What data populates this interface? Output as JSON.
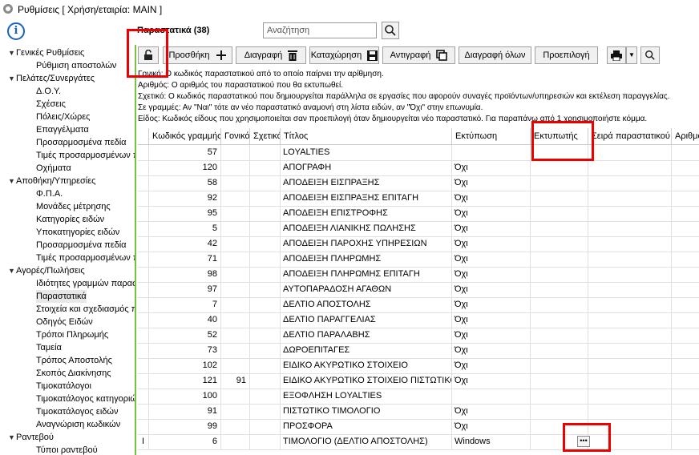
{
  "window": {
    "title": "Ρυθμίσεις   [ Χρήση/εταιρία: MAIN ]"
  },
  "sidebar": {
    "items": [
      {
        "label": "Γενικές Ρυθμίσεις",
        "group": true
      },
      {
        "label": "Ρύθμιση αποστολών",
        "group": false
      },
      {
        "label": "Πελάτες/Συνεργάτες",
        "group": true
      },
      {
        "label": "Δ.Ο.Υ.",
        "group": false
      },
      {
        "label": "Σχέσεις",
        "group": false
      },
      {
        "label": "Πόλεις/Χώρες",
        "group": false
      },
      {
        "label": "Επαγγέλματα",
        "group": false
      },
      {
        "label": "Προσαρμοσμένα πεδία",
        "group": false
      },
      {
        "label": "Τιμές προσαρμοσμένων π",
        "group": false
      },
      {
        "label": "Οχήματα",
        "group": false
      },
      {
        "label": "Αποθήκη/Υπηρεσίες",
        "group": true
      },
      {
        "label": "Φ.Π.Α.",
        "group": false
      },
      {
        "label": "Μονάδες μέτρησης",
        "group": false
      },
      {
        "label": "Κατηγορίες ειδών",
        "group": false
      },
      {
        "label": "Υποκατηγορίες ειδών",
        "group": false
      },
      {
        "label": "Προσαρμοσμένα πεδία",
        "group": false
      },
      {
        "label": "Τιμές προσαρμοσμένων π",
        "group": false
      },
      {
        "label": "Αγορές/Πωλήσεις",
        "group": true
      },
      {
        "label": "Ιδιότητες γραμμών παρασ",
        "group": false
      },
      {
        "label": "Παραστατικά",
        "group": false,
        "selected": true
      },
      {
        "label": "Στοιχεία και σχεδιασμός π",
        "group": false
      },
      {
        "label": "Οδηγός Ειδών",
        "group": false
      },
      {
        "label": "Τρόποι Πληρωμής",
        "group": false
      },
      {
        "label": "Ταμεία",
        "group": false
      },
      {
        "label": "Τρόπος Αποστολής",
        "group": false
      },
      {
        "label": "Σκοπός Διακίνησης",
        "group": false
      },
      {
        "label": "Τιμοκατάλογοι",
        "group": false
      },
      {
        "label": "Τιμοκατάλογος κατηγοριώ",
        "group": false
      },
      {
        "label": "Τιμοκατάλογος ειδών",
        "group": false
      },
      {
        "label": "Αναγνώριση κωδικών",
        "group": false
      },
      {
        "label": "Ραντεβού",
        "group": true
      },
      {
        "label": "Τύποι ραντεβού",
        "group": false
      }
    ]
  },
  "main": {
    "section_title": "Παραστατικά (38)",
    "search_placeholder": "Αναζήτηση"
  },
  "toolbar": {
    "add": "Προσθήκη",
    "delete": "Διαγραφή",
    "save": "Καταχώρηση",
    "copy": "Αντιγραφή",
    "delete_all": "Διαγραφή όλων",
    "default": "Προεπιλογή"
  },
  "info_lines": [
    "Γονικό: Ο κωδικός παραστατικού από το οποίο παίρνει την αρίθμηση.",
    "Αριθμός: Ο αριθμός του παραστατικού που θα εκτυπωθεί.",
    "Σχετικό: Ο κωδικός παραστατικού που δημιουργείται παράλληλα σε εργασίες που αφορούν συναγές προϊόντων/υπηρεσιών και εκτέλεση παραγγελίας.",
    "Σε γραμμές: Αν \"Ναι\" τότε αν νέο παραστατικό αναμονή στη λίστα ειδών, αν \"Όχι\" στην επωνυμία.",
    "Είδος: Κωδικός είδους που χρησιμοποιείται σαν προεπιλογή όταν δημιουργείται νέο παραστατικό. Για παραπάνω από 1 χρησιμοποιήστε κόμμα."
  ],
  "grid": {
    "columns": [
      "Κωδικός γραμμής",
      "Γονικό",
      "Σχετικό",
      "Τίτλος",
      "Εκτύπωση",
      "Εκτυπωτής",
      "Σειρά παραστατικού",
      "Αριθμό"
    ],
    "rows": [
      {
        "code": "57",
        "parent": "",
        "title": "LOYALTIES",
        "print": "",
        "printer": ""
      },
      {
        "code": "120",
        "parent": "",
        "title": "ΑΠΟΓΡΑΦΗ",
        "print": "Όχι",
        "printer": ""
      },
      {
        "code": "58",
        "parent": "",
        "title": "ΑΠΟΔΕΙΞΗ ΕΙΣΠΡΑΞΗΣ",
        "print": "Όχι",
        "printer": ""
      },
      {
        "code": "92",
        "parent": "",
        "title": "ΑΠΟΔΕΙΞΗ ΕΙΣΠΡΑΞΗΣ ΕΠΙΤΑΓΗ",
        "print": "Όχι",
        "printer": ""
      },
      {
        "code": "95",
        "parent": "",
        "title": "ΑΠΟΔΕΙΞΗ ΕΠΙΣΤΡΟΦΗΣ",
        "print": "Όχι",
        "printer": ""
      },
      {
        "code": "5",
        "parent": "",
        "title": "ΑΠΟΔΕΙΞΗ ΛΙΑΝΙΚΗΣ ΠΩΛΗΣΗΣ",
        "print": "Όχι",
        "printer": ""
      },
      {
        "code": "42",
        "parent": "",
        "title": "ΑΠΟΔΕΙΞΗ ΠΑΡΟΧΗΣ ΥΠΗΡΕΣΙΩΝ",
        "print": "Όχι",
        "printer": ""
      },
      {
        "code": "71",
        "parent": "",
        "title": "ΑΠΟΔΕΙΞΗ ΠΛΗΡΩΜΗΣ",
        "print": "Όχι",
        "printer": ""
      },
      {
        "code": "98",
        "parent": "",
        "title": "ΑΠΟΔΕΙΞΗ ΠΛΗΡΩΜΗΣ ΕΠΙΤΑΓΗ",
        "print": "Όχι",
        "printer": ""
      },
      {
        "code": "97",
        "parent": "",
        "title": "ΑΥΤΟΠΑΡΑΔΟΣΗ ΑΓΑΘΩΝ",
        "print": "Όχι",
        "printer": ""
      },
      {
        "code": "7",
        "parent": "",
        "title": "ΔΕΛΤΙΟ ΑΠΟΣΤΟΛΗΣ",
        "print": "Όχι",
        "printer": ""
      },
      {
        "code": "40",
        "parent": "",
        "title": "ΔΕΛΤΙΟ ΠΑΡΑΓΓΕΛΙΑΣ",
        "print": "Όχι",
        "printer": ""
      },
      {
        "code": "52",
        "parent": "",
        "title": "ΔΕΛΤΙΟ ΠΑΡΑΛΑΒΗΣ",
        "print": "Όχι",
        "printer": ""
      },
      {
        "code": "73",
        "parent": "",
        "title": "ΔΩΡΟΕΠΙΤΑΓΕΣ",
        "print": "Όχι",
        "printer": ""
      },
      {
        "code": "102",
        "parent": "",
        "title": "ΕΙΔΙΚΟ ΑΚΥΡΩΤΙΚΟ ΣΤΟΙΧΕΙΟ",
        "print": "Όχι",
        "printer": ""
      },
      {
        "code": "121",
        "parent": "91",
        "title": "ΕΙΔΙΚΟ ΑΚΥΡΩΤΙΚΟ ΣΤΟΙΧΕΙΟ ΠΙΣΤΩΤΙΚΟ",
        "print": "Όχι",
        "printer": ""
      },
      {
        "code": "100",
        "parent": "",
        "title": "ΕΞΟΦΛΗΣΗ LOYALTIES",
        "print": "",
        "printer": ""
      },
      {
        "code": "91",
        "parent": "",
        "title": "ΠΙΣΤΩΤΙΚΟ ΤΙΜΟΛΟΓΙΟ",
        "print": "Όχι",
        "printer": ""
      },
      {
        "code": "99",
        "parent": "",
        "title": "ΠΡΟΣΦΟΡΑ",
        "print": "Όχι",
        "printer": ""
      },
      {
        "code": "6",
        "parent": "",
        "title": "ΤΙΜΟΛΟΓΙΟ (ΔΕΛΤΙΟ ΑΠΟΣΤΟΛΗΣ)",
        "print": "Windows",
        "printer": "",
        "editing": true
      }
    ]
  }
}
